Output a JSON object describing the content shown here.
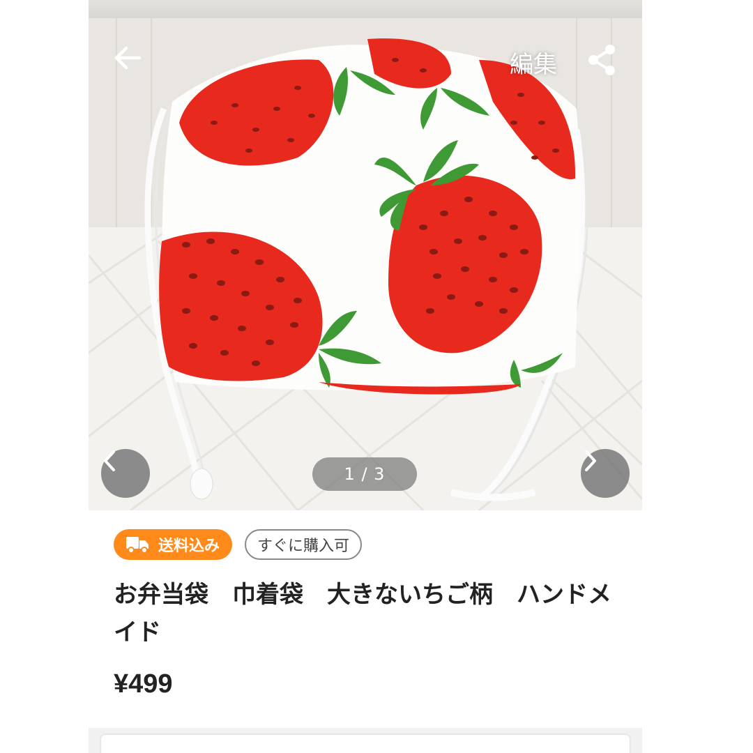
{
  "header": {
    "back_icon": "arrow-left-icon",
    "edit_label": "編集",
    "share_icon": "share-icon"
  },
  "gallery": {
    "counter": "1 / 3",
    "prev_icon": "chevron-left-icon",
    "next_icon": "chevron-right-icon",
    "image_subject": "strawberry-drawstring-bag-photo"
  },
  "badges": {
    "shipping_label": "送料込み",
    "shipping_icon": "truck-icon",
    "buy_label": "すぐに購入可"
  },
  "product": {
    "title": "お弁当袋　巾着袋　大きないちご柄　ハンドメイド",
    "price": "¥499"
  },
  "colors": {
    "badge_orange": "#ff8a1a",
    "strawberry_red": "#e8291d",
    "leaf_green": "#3f9a35"
  }
}
